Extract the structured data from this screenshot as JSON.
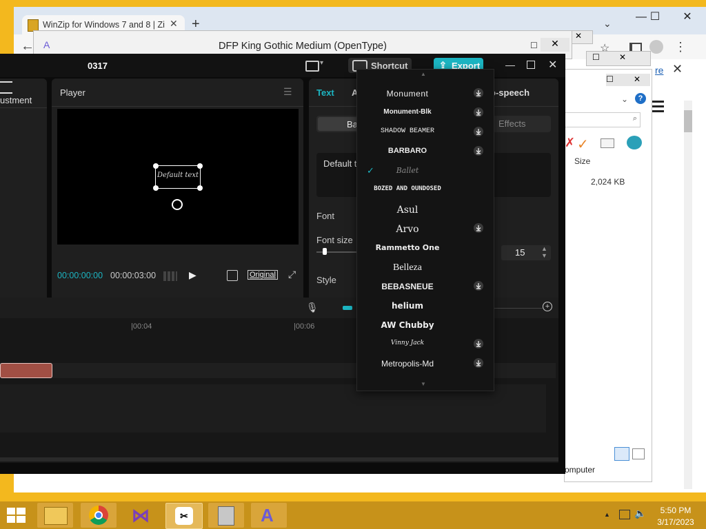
{
  "chrome": {
    "tab_title": "WinZip for Windows 7 and 8 | Zi",
    "new_tab": "+",
    "controls": {
      "minimize": "—",
      "maximize": "☐",
      "close": "✕"
    }
  },
  "dfp_window": {
    "title": "DFP King Gothic Medium (OpenType)"
  },
  "explorer": {
    "column_size": "Size",
    "file_size": "2,024 KB",
    "status": "omputer",
    "link_fragment": "re"
  },
  "capcut": {
    "title": "0317",
    "shortcut_label": "Shortcut",
    "export_label": "Export",
    "adjustment_label": "ustment",
    "player_label": "Player",
    "timecode_current": "00:00:00:00",
    "timecode_total": "00:00:03:00",
    "original_label": "Original",
    "preview_text": "Default text",
    "tabs": {
      "text": "Text",
      "a": "A",
      "tts": "o-speech"
    },
    "subtabs": {
      "basic": "Ba",
      "effects": "Effects"
    },
    "default_text_box": "Default t",
    "font_label": "Font",
    "font_size_label": "Font size",
    "font_size_value": "15",
    "style_label": "Style",
    "timeline_ticks": [
      "|00:04",
      "|00:06"
    ]
  },
  "font_dropdown": {
    "items": [
      {
        "name": "Monument",
        "download": true,
        "selected": false
      },
      {
        "name": "Monument-Blk",
        "download": true,
        "selected": false
      },
      {
        "name": "SHADOW BEAMER",
        "download": true,
        "selected": false
      },
      {
        "name": "BARBARO",
        "download": true,
        "selected": false
      },
      {
        "name": "Ballet",
        "download": false,
        "selected": true
      },
      {
        "name": "BOZED AND OUNDOSED",
        "download": false,
        "selected": false
      },
      {
        "name": "Asul",
        "download": false,
        "selected": false
      },
      {
        "name": "Arvo",
        "download": true,
        "selected": false
      },
      {
        "name": "Rammetto One",
        "download": false,
        "selected": false
      },
      {
        "name": "Belleza",
        "download": false,
        "selected": false
      },
      {
        "name": "BEBASNEUE",
        "download": true,
        "selected": false
      },
      {
        "name": "helium",
        "download": false,
        "selected": false
      },
      {
        "name": "AW Chubby",
        "download": false,
        "selected": false
      },
      {
        "name": "Vinny Jack",
        "download": true,
        "selected": false
      },
      {
        "name": "Metropolis-Md",
        "download": true,
        "selected": false
      }
    ]
  },
  "taskbar": {
    "time": "5:50 PM",
    "date": "3/17/2023"
  },
  "colors": {
    "accent": "#1cb5c2",
    "desktop": "#f3b81e",
    "taskbar": "#c7921a"
  }
}
